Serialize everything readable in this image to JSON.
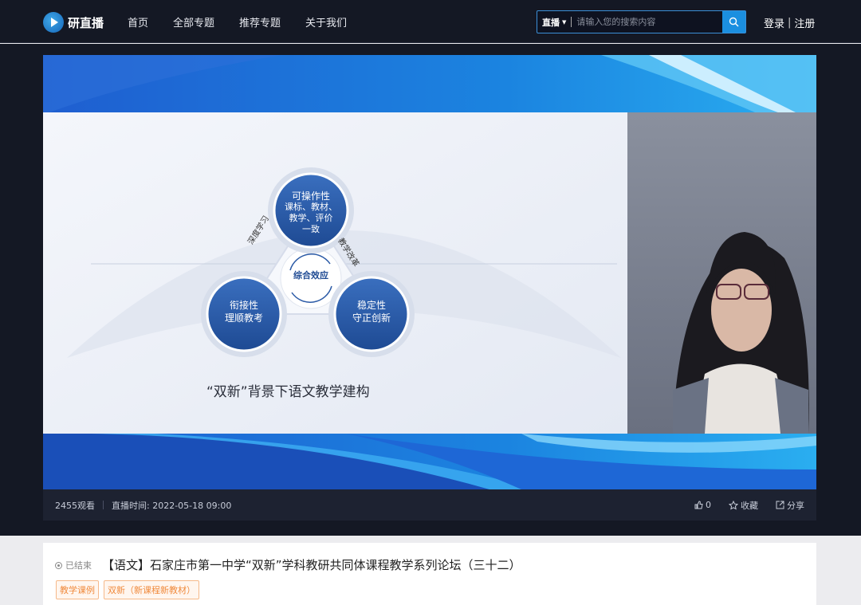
{
  "header": {
    "logo_text": "研直播",
    "nav": [
      "首页",
      "全部专题",
      "推荐专题",
      "关于我们"
    ],
    "search": {
      "category": "直播",
      "placeholder": "请输入您的搜索内容"
    },
    "login": "登录",
    "divider": "|",
    "register": "注册"
  },
  "slide": {
    "top_node": [
      "可操作性",
      "课标、教材、",
      "教学、评价",
      "一致"
    ],
    "left_node": [
      "衔接性",
      "理顺教考"
    ],
    "right_node": [
      "稳定性",
      "守正创新"
    ],
    "center": "综合效应",
    "left_arc": "深度学习",
    "right_arc": "教学改革",
    "caption": "“双新”背景下语文教学建构"
  },
  "video_bar": {
    "views": "2455观看",
    "time_label": "直播时间: 2022-05-18 09:00",
    "likes": "0",
    "favorite": "收藏",
    "share": "分享"
  },
  "info": {
    "status": "已结束",
    "title": "【语文】石家庄市第一中学“双新”学科教研共同体课程教学系列论坛（三十二）",
    "tags": [
      "教学课例",
      "双新（新课程新教材）"
    ]
  },
  "colors": {
    "accent": "#1b8fe0",
    "tag": "#f08a3c",
    "dark": "#141824"
  }
}
